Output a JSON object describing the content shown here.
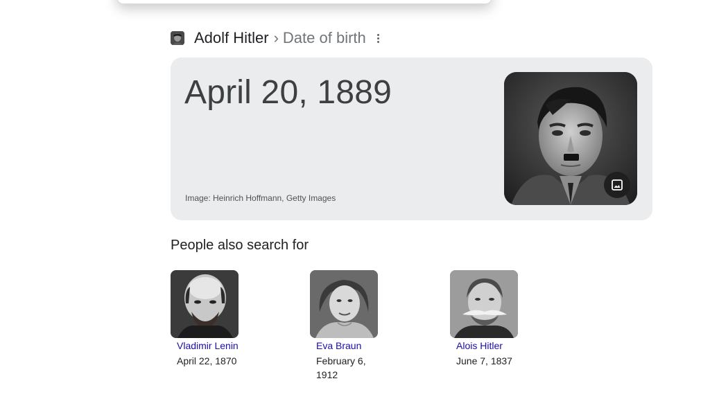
{
  "breadcrumb": {
    "entity": "Adolf Hitler",
    "separator": "›",
    "attribute": "Date of birth"
  },
  "answer": {
    "value": "April 20, 1889",
    "image_credit": "Image: Heinrich Hoffmann, Getty Images"
  },
  "people_also_search": {
    "title": "People also search for",
    "people": [
      {
        "name": "Vladimir Lenin",
        "date": "April 22, 1870"
      },
      {
        "name": "Eva Braun",
        "date": "February 6, 1912"
      },
      {
        "name": "Alois Hitler",
        "date": "June 7, 1837"
      }
    ]
  },
  "icons": {
    "more": "more-vert-icon",
    "image_badge": "image-icon"
  },
  "colors": {
    "card_bg": "#ebecee",
    "link": "#1a0dab",
    "secondary_text": "#70757a",
    "primary_text": "#202124"
  }
}
